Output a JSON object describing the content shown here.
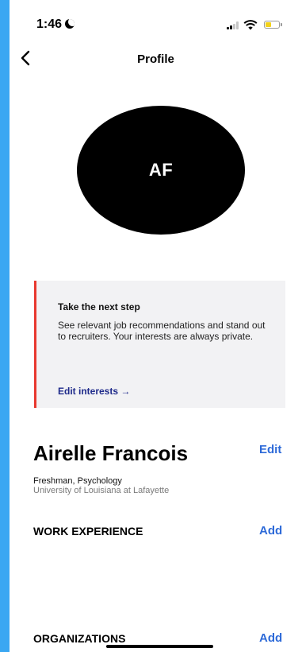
{
  "status_bar": {
    "time": "1:46",
    "battery_color": "#f3d21a",
    "battery_level": 0.45
  },
  "nav": {
    "title": "Profile",
    "back_icon": "chevron-left-icon"
  },
  "avatar": {
    "initials": "AF",
    "background": "#000000"
  },
  "next_step_card": {
    "title": "Take the next step",
    "body": "See relevant job recommendations and stand out to recruiters. Your interests are always private.",
    "link_label": "Edit interests →",
    "accent_color": "#e8382f"
  },
  "profile": {
    "name": "Airelle Francois",
    "edit_label": "Edit",
    "subtitle": "Freshman, Psychology",
    "school": "University of Louisiana at Lafayette"
  },
  "sections": [
    {
      "heading": "WORK EXPERIENCE",
      "action_label": "Add"
    },
    {
      "heading": "ORGANIZATIONS",
      "action_label": "Add"
    }
  ],
  "colors": {
    "link_blue": "#2d6ad8",
    "frame_blue": "#3aa7f2"
  }
}
